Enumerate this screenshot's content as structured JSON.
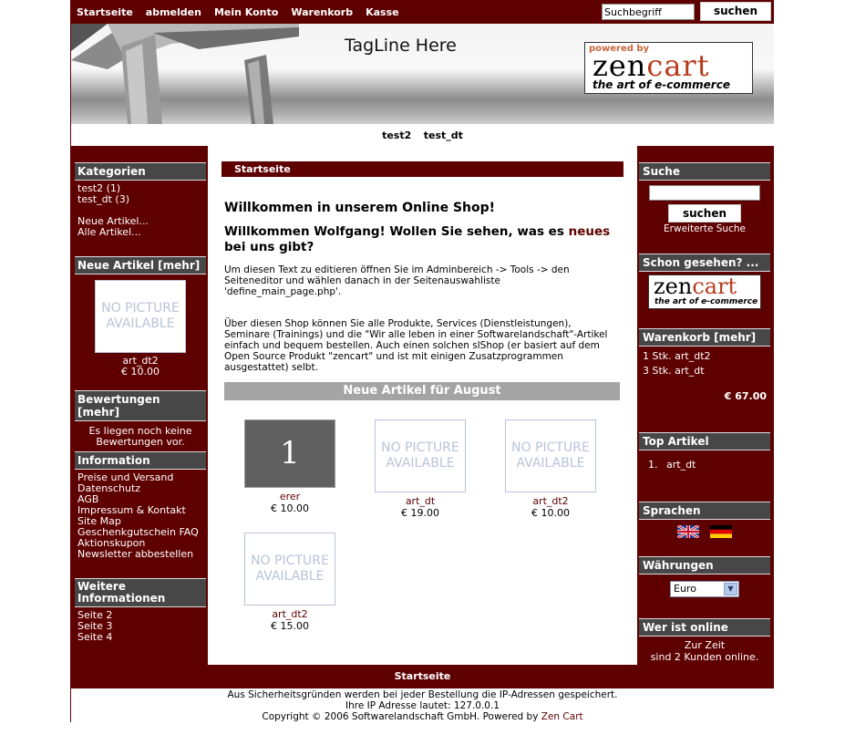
{
  "topnav": {
    "links": [
      "Startseite",
      "abmelden",
      "Mein Konto",
      "Warenkorb",
      "Kasse"
    ],
    "search_value": "Suchbegriff",
    "search_button": "suchen"
  },
  "header": {
    "tagline": "TagLine Here",
    "logo_powered": "powered by",
    "logo_zen": "zen",
    "logo_cart": "cart",
    "logo_art": "the art of e-commerce"
  },
  "categories_bar": [
    "test2",
    "test_dt"
  ],
  "left": {
    "kategorien": {
      "title": "Kategorien",
      "items": [
        "test2 (1)",
        "test_dt (3)"
      ],
      "extra": [
        "Neue Artikel...",
        "Alle Artikel..."
      ]
    },
    "neue_artikel": {
      "title": "Neue Artikel  [mehr]",
      "nopic": "NO PICTURE AVAILABLE",
      "name": "art_dt2",
      "price": "€ 10.00"
    },
    "bewertungen": {
      "title": "Bewertungen  [mehr]",
      "text": "Es liegen noch keine Bewertungen vor."
    },
    "information": {
      "title": "Information",
      "items": [
        "Preise und Versand",
        "Datenschutz",
        "AGB",
        "Impressum & Kontakt",
        "Site Map",
        "Geschenkgutschein FAQ",
        "Aktionskupon",
        "Newsletter abbestellen"
      ]
    },
    "weitere": {
      "title": "Weitere Informationen",
      "items": [
        "Seite 2",
        "Seite 3",
        "Seite 4"
      ]
    }
  },
  "center": {
    "breadcrumb": "Startseite",
    "welcome": "Willkommen in unserem Online Shop!",
    "greeting_pre": "Willkommen Wolfgang! Wollen Sie sehen, was es ",
    "greeting_link": "neues",
    "greeting_post": " bei uns gibt?",
    "para1": "Um diesen Text zu editieren öffnen Sie im Adminbereich -> Tools -> den Seiteneditor und wählen danach in der Seitenauswahliste 'define_main_page.php'.",
    "para2": "Über diesen Shop können Sie alle Produkte, Services (Dienstleistungen), Seminare (Trainings) und die \"Wir alle leben in einer Softwarelandschaft\"-Artikel einfach und bequem bestellen. Auch einen solchen slShop (er basiert auf dem Open Source Produkt \"zencart\" und ist mit einigen Zusatzprogrammen ausgestattet) selbt.",
    "new_heading": "Neue Artikel für August",
    "nopic": "NO PICTURE AVAILABLE",
    "products": [
      {
        "image_text": "1",
        "name": "erer",
        "price": "€ 10.00"
      },
      {
        "name": "art_dt",
        "price": "€ 19.00"
      },
      {
        "name": "art_dt2",
        "price": "€ 10.00"
      },
      {
        "name": "art_dt2",
        "price": "€ 15.00"
      }
    ]
  },
  "right": {
    "suche": {
      "title": "Suche",
      "button": "suchen",
      "advanced": "Erweiterte Suche"
    },
    "schon": {
      "title": "Schon gesehen? ...",
      "logo_zen": "zen",
      "logo_cart": "cart",
      "logo_art": "the art of e-commerce"
    },
    "warenkorb": {
      "title": "Warenkorb  [mehr]",
      "items": [
        "1 Stk. art_dt2",
        "3 Stk. art_dt"
      ],
      "total": "€ 67.00"
    },
    "top": {
      "title": "Top Artikel",
      "item_no": "1.",
      "item": "art_dt"
    },
    "sprachen": {
      "title": "Sprachen"
    },
    "waehrungen": {
      "title": "Währungen",
      "selected": "Euro"
    },
    "online": {
      "title": "Wer ist online",
      "line1": "Zur Zeit",
      "line2": "sind 2 Kunden online."
    }
  },
  "footer": {
    "bar": "Startseite",
    "line1": "Aus Sicherheitsgründen werden bei jeder Bestellung die IP-Adressen gespeichert.",
    "line2": "Ihre IP Adresse lautet: 127.0.0.1",
    "line3_pre": "Copyright © 2006 Softwarelandschaft GmbH. Powered by ",
    "line3_link": "Zen Cart"
  }
}
